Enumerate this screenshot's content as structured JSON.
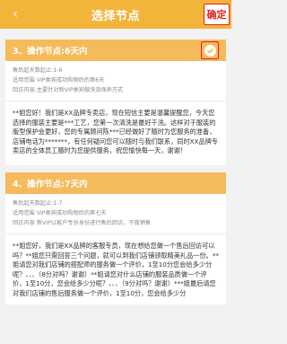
{
  "header": {
    "title": "选择节点",
    "confirm_label": "确定",
    "back_glyph": "‹"
  },
  "nodes": [
    {
      "title": "3、操作节点:6天内",
      "selected": true,
      "meta": [
        "售后起天数起止:1-6",
        "适用范围 VIP类宾成功购物后的第6天",
        "回访内容:主要针对新VIP类宾做洗涤保养方式"
      ],
      "content": "**姐您好！我们是XX品牌专卖店，现在短信主要是温馨提醒您，今天您选择的服装主要是***工艺，您第一次清洗是最好干洗。这样对于服装的版型保护会更好，您的专属顾问陈***已经做好了随时为您服务的准备，店铺电话为*******，有任何疑问您可以随时与我们联系，同时XX品牌专卖店的全体员工随时为您提供服务，祝您愉快每一天，谢谢！"
    },
    {
      "title": "4、操作节点:7天内",
      "selected": false,
      "meta": [
        "售后起天数起止:1-7",
        "适用范围 VIP类宾成功购物后的第七天",
        "回访内容 新VIP以客户专员身份进行售后回访，不做销售"
      ],
      "content": "**姐您好，我们是XX品牌的客服专员，现在想给您做一个售后回访可以吗？**姐您只需回答三个问题，就可以到我们店铺领取精美礼品一份。**姐请您对我们店铺的搭配师的服务做一个评价，1至10分您会给多少分呢？、、、（8分对吗？谢谢）**姐请您对什么店铺的服装品质做一个评价，1至10分，您会给多少分呢？、、、（9分对吗？谢谢）***姐最后请您对我们店铺的售后服务做一个评价，1至10分，您会给多少分"
    }
  ]
}
